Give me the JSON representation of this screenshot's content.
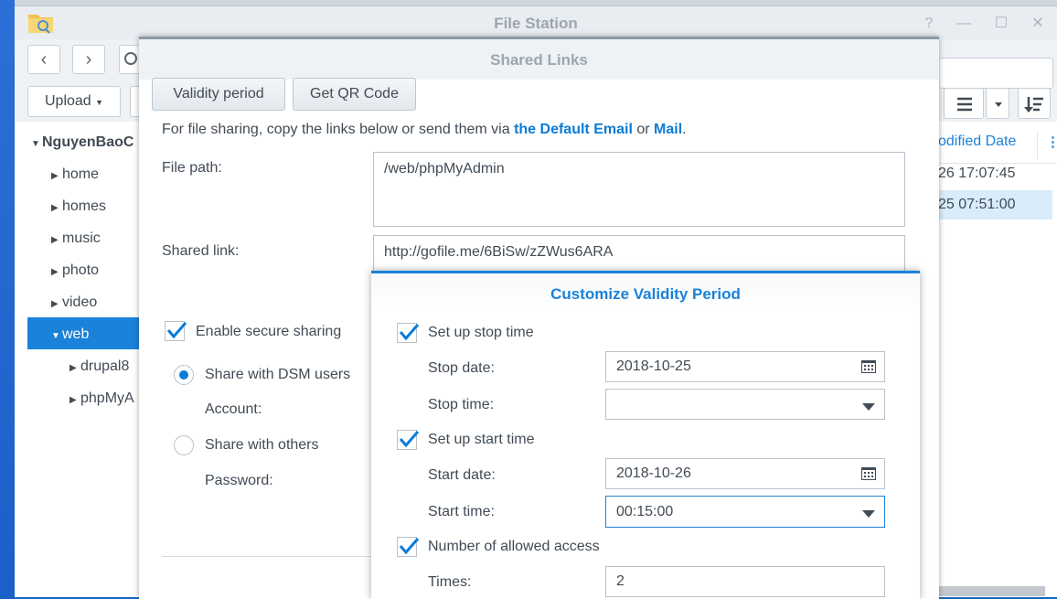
{
  "app": {
    "title": "File Station"
  },
  "toolbar": {
    "upload": "Upload"
  },
  "tree": {
    "root": "NguyenBaoC",
    "items": [
      "home",
      "homes",
      "music",
      "photo",
      "video",
      "web"
    ],
    "subitems": [
      "drupal8",
      "phpMyA"
    ]
  },
  "filelist": {
    "column": "odified Date",
    "rows": [
      "26 17:07:45",
      "25 07:51:00"
    ]
  },
  "modal": {
    "title": "Shared Links",
    "validity_btn": "Validity period",
    "qr_btn": "Get QR Code",
    "desc_start": "For file sharing, copy the links below or send them via",
    "desc_link1": "the Default Email",
    "desc_or": "or",
    "desc_link2": "Mail",
    "desc_end": ".",
    "file_path_label": "File path:",
    "file_path_value": "/web/phpMyAdmin",
    "shared_link_label": "Shared link:",
    "shared_link_value": "http://gofile.me/6BiSw/zZWus6ARA",
    "secure_label": "Enable secure sharing",
    "share_dsm": "Share with DSM users",
    "account_label": "Account:",
    "share_others": "Share with others",
    "password_label": "Password:"
  },
  "popup": {
    "title": "Customize Validity Period",
    "stop_check": "Set up stop time",
    "stop_date_label": "Stop date:",
    "stop_date_value": "2018-10-25",
    "stop_time_label": "Stop time:",
    "stop_time_value": "",
    "start_check": "Set up start time",
    "start_date_label": "Start date:",
    "start_date_value": "2018-10-26",
    "start_time_label": "Start time:",
    "start_time_value": "00:15:00",
    "access_check": "Number of allowed access",
    "times_label": "Times:",
    "times_value": "2"
  },
  "colors": {
    "accent": "#0a7bd6",
    "selected": "#1b82d9"
  }
}
